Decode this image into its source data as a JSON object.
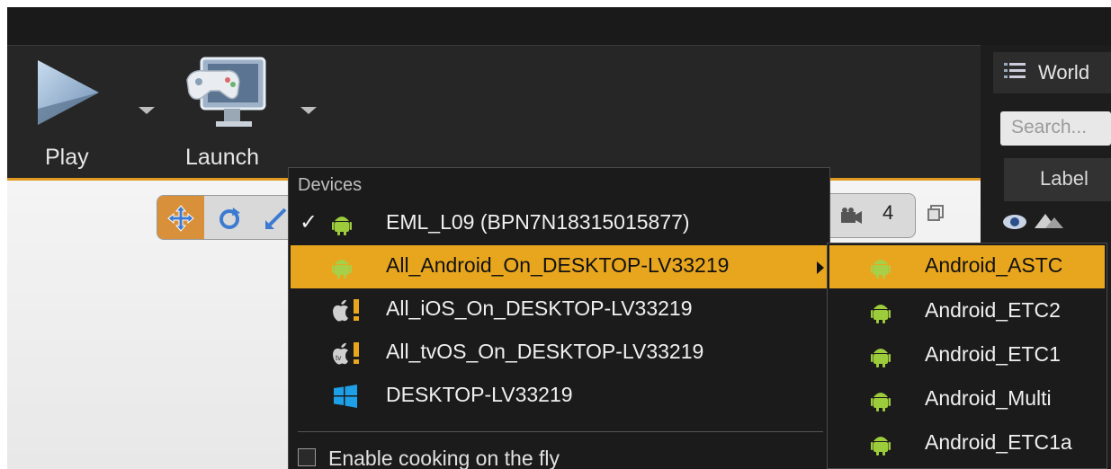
{
  "toolbar": {
    "play_label": "Play",
    "launch_label": "Launch"
  },
  "viewport": {
    "camera_speed": "4"
  },
  "right_panel": {
    "tab_label": "World",
    "search_placeholder": "Search...",
    "column_label": "Label"
  },
  "devices_menu": {
    "heading": "Devices",
    "items": [
      {
        "label": "EML_L09 (BPN7N18315015877)",
        "icon": "android-icon",
        "checked": true
      },
      {
        "label": "All_Android_On_DESKTOP-LV33219",
        "icon": "android-icon",
        "highlighted": true,
        "has_submenu": true
      },
      {
        "label": "All_iOS_On_DESKTOP-LV33219",
        "icon": "apple-warning-icon"
      },
      {
        "label": "All_tvOS_On_DESKTOP-LV33219",
        "icon": "appletv-warning-icon"
      },
      {
        "label": "DESKTOP-LV33219",
        "icon": "windows-icon"
      }
    ],
    "cooking_label": "Enable cooking on the fly"
  },
  "android_submenu": {
    "items": [
      {
        "label": "Android_ASTC",
        "highlighted": true
      },
      {
        "label": "Android_ETC2"
      },
      {
        "label": "Android_ETC1"
      },
      {
        "label": "Android_Multi"
      },
      {
        "label": "Android_ETC1a"
      }
    ]
  },
  "colors": {
    "accent": "#e8a61e",
    "android_green": "#9ccc3c",
    "menu_bg": "#1b1b1b",
    "toolbar_bg": "#262626"
  }
}
